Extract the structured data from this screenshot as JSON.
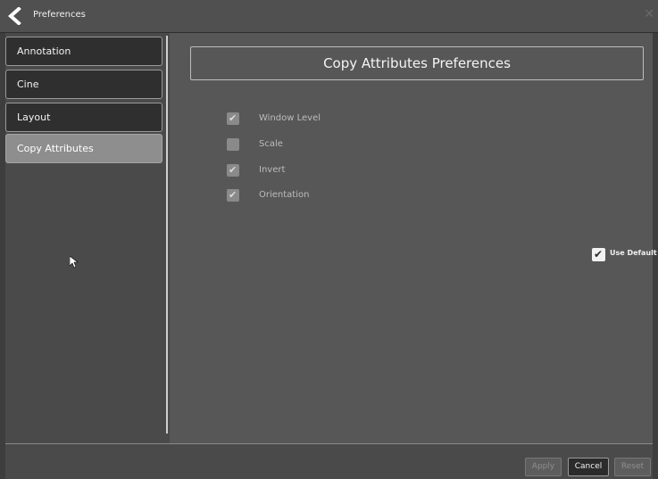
{
  "window": {
    "title": "Preferences",
    "back_icon": "chevron-left-icon",
    "close_icon": "close-icon"
  },
  "sidebar": {
    "items": [
      {
        "label": "Annotation",
        "active": false
      },
      {
        "label": "Cine",
        "active": false
      },
      {
        "label": "Layout",
        "active": false
      },
      {
        "label": "Copy Attributes",
        "active": true
      }
    ]
  },
  "main": {
    "header": "Copy Attributes Preferences",
    "options": [
      {
        "label": "Window Level",
        "checked": true
      },
      {
        "label": "Scale",
        "checked": false
      },
      {
        "label": "Invert",
        "checked": true
      },
      {
        "label": "Orientation",
        "checked": true
      }
    ],
    "use_default": {
      "label": "Use Default",
      "checked": true
    }
  },
  "footer": {
    "apply_label": "Apply",
    "cancel_label": "Cancel",
    "reset_label": "Reset"
  },
  "colors": {
    "background": "#4a4a4a",
    "content": "#575757",
    "active_nav": "#8e8e8e",
    "nav": "#2f2f2f"
  }
}
